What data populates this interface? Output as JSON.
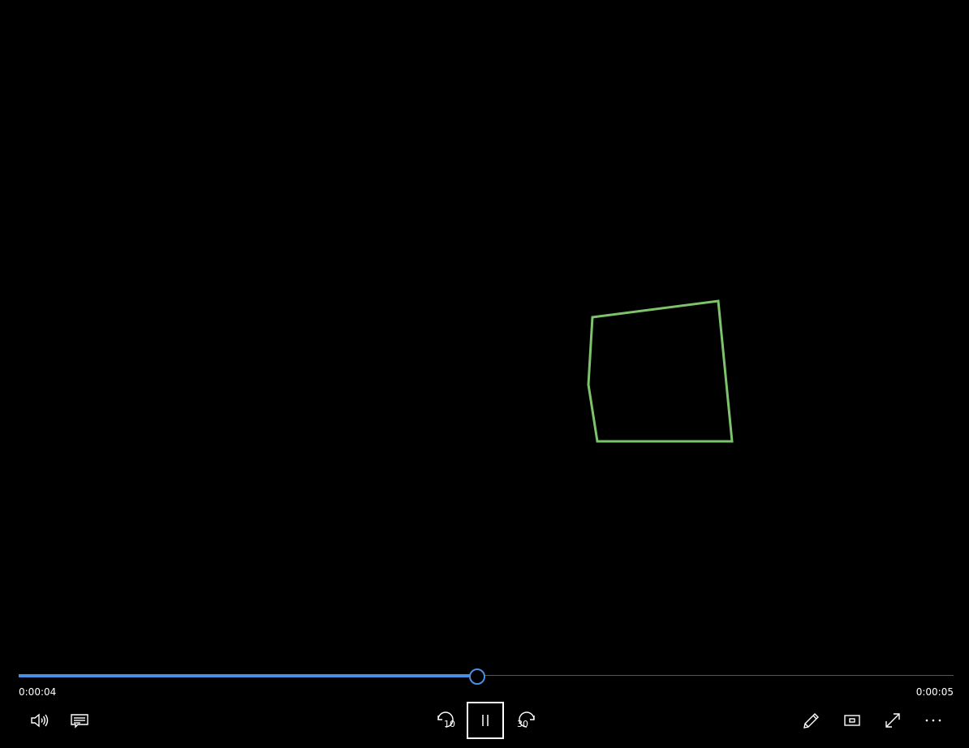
{
  "playback": {
    "elapsed": "0:00:04",
    "total": "0:00:05",
    "progress": 0.49
  },
  "controls": {
    "left": [
      {
        "name": "volume-icon"
      },
      {
        "name": "captions-icon"
      }
    ],
    "center": {
      "skip_back_label": "10",
      "play_pause_state": "playing",
      "skip_forward_label": "30"
    },
    "right": [
      {
        "name": "pencil-icon"
      },
      {
        "name": "mini-view-icon"
      },
      {
        "name": "fullscreen-icon"
      },
      {
        "name": "more-options-icon"
      }
    ]
  },
  "colors": {
    "background": "#000000",
    "accent": "#4a90e2",
    "shape_stroke": "#7dc36b"
  }
}
